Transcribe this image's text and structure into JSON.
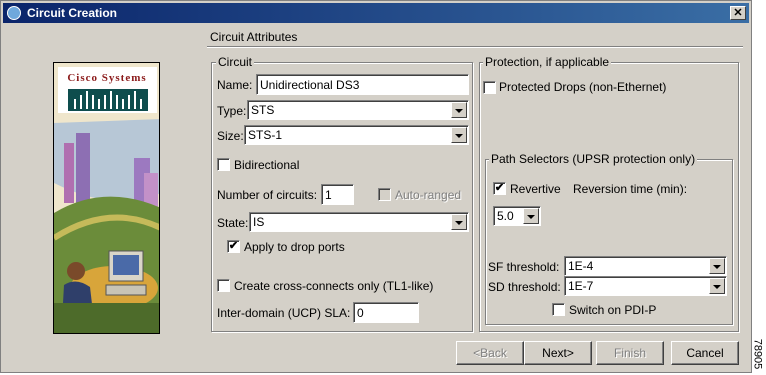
{
  "window": {
    "title": "Circuit Creation",
    "close_glyph": "✕"
  },
  "sidebar": {
    "logo_text": "Cisco Systems"
  },
  "section_header": "Circuit Attributes",
  "circuit": {
    "group_title": "Circuit",
    "name_label": "Name:",
    "name_value": "Unidirectional DS3",
    "type_label": "Type:",
    "type_value": "STS",
    "size_label": "Size:",
    "size_value": "STS-1",
    "bidirectional_label": "Bidirectional",
    "bidirectional_checked": false,
    "num_circuits_label": "Number of circuits:",
    "num_circuits_value": "1",
    "auto_ranged_label": "Auto-ranged",
    "state_label": "State:",
    "state_value": "IS",
    "apply_drop_ports_label": "Apply to drop ports",
    "apply_drop_ports_checked": true,
    "cross_connects_label": "Create cross-connects only (TL1-like)",
    "cross_connects_checked": false,
    "sla_label": "Inter-domain (UCP) SLA:",
    "sla_value": "0"
  },
  "protection": {
    "group_title": "Protection, if applicable",
    "protected_drops_label": "Protected Drops (non-Ethernet)",
    "protected_drops_checked": false,
    "path_selectors": {
      "group_title": "Path Selectors (UPSR protection only)",
      "revertive_label": "Revertive",
      "revertive_checked": true,
      "reversion_time_label": "Reversion time (min):",
      "reversion_time_value": "5.0",
      "sf_threshold_label": "SF threshold:",
      "sf_threshold_value": "1E-4",
      "sd_threshold_label": "SD threshold:",
      "sd_threshold_value": "1E-7",
      "switch_pdip_label": "Switch on PDI-P",
      "switch_pdip_checked": false
    }
  },
  "buttons": {
    "back": "<Back",
    "next": "Next>",
    "finish": "Finish",
    "cancel": "Cancel"
  },
  "figure_number": "78905",
  "colors": {
    "titlebar": "#0a246a",
    "face": "#d4d0c8"
  },
  "check_glyph": "✔"
}
